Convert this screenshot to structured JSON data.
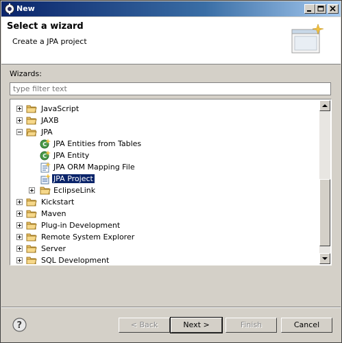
{
  "window": {
    "title": "New"
  },
  "banner": {
    "title": "Select a wizard",
    "description": "Create a JPA project"
  },
  "wizards_label": "Wizards:",
  "filter": {
    "value": "",
    "placeholder": "type filter text"
  },
  "tree": {
    "items": [
      {
        "label": "JavaScript",
        "kind": "folder",
        "expander": "plus"
      },
      {
        "label": "JAXB",
        "kind": "folder",
        "expander": "plus"
      },
      {
        "label": "JPA",
        "kind": "folder",
        "expander": "minus"
      },
      {
        "label": "JPA Entities from Tables",
        "kind": "jpa-entity-icon"
      },
      {
        "label": "JPA Entity",
        "kind": "jpa-entity-icon"
      },
      {
        "label": "JPA ORM Mapping File",
        "kind": "orm-file-icon"
      },
      {
        "label": "JPA Project",
        "kind": "jpa-project-icon",
        "selected": true
      },
      {
        "label": "EclipseLink",
        "kind": "folder",
        "expander": "plus"
      },
      {
        "label": "Kickstart",
        "kind": "folder",
        "expander": "plus"
      },
      {
        "label": "Maven",
        "kind": "folder",
        "expander": "plus"
      },
      {
        "label": "Plug-in Development",
        "kind": "folder",
        "expander": "plus"
      },
      {
        "label": "Remote System Explorer",
        "kind": "folder",
        "expander": "plus"
      },
      {
        "label": "Server",
        "kind": "folder",
        "expander": "plus"
      },
      {
        "label": "SQL Development",
        "kind": "folder",
        "expander": "plus"
      }
    ]
  },
  "buttons": {
    "back": "< Back",
    "next": "Next >",
    "finish": "Finish",
    "cancel": "Cancel"
  },
  "colors": {
    "selection": "#0a246a",
    "folder": "#e8c068",
    "titlebar": "#0a246a"
  }
}
